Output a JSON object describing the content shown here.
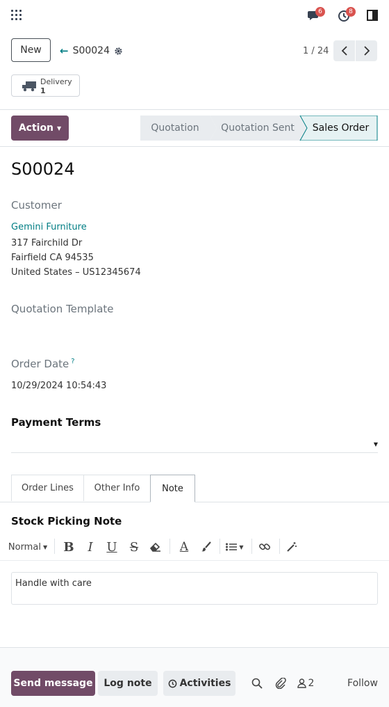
{
  "header": {
    "messages_badge": "6",
    "activities_badge": "8"
  },
  "control_panel": {
    "new_label": "New",
    "breadcrumb": "S00024",
    "pager": "1 / 24",
    "smart_button": {
      "title": "Delivery",
      "count": "1"
    }
  },
  "statusbar": {
    "action_label": "Action",
    "stages": [
      "Quotation",
      "Quotation Sent",
      "Sales Order"
    ],
    "active_stage": "Sales Order"
  },
  "form": {
    "title": "S00024",
    "customer_label": "Customer",
    "customer_name": "Gemini Furniture",
    "address_line1": "317 Fairchild Dr",
    "address_line2": "Fairfield CA 94535",
    "address_line3": "United States – US12345674",
    "quotation_template_label": "Quotation Template",
    "order_date_label": "Order Date",
    "order_date_help": "?",
    "order_date_value": "10/29/2024 10:54:43",
    "payment_terms_label": "Payment Terms",
    "payment_terms_value": ""
  },
  "tabs": [
    {
      "label": "Order Lines"
    },
    {
      "label": "Other Info"
    },
    {
      "label": "Note"
    }
  ],
  "note": {
    "heading": "Stock Picking Note",
    "style_select": "Normal",
    "content": "Handle with care"
  },
  "chatter": {
    "send_message": "Send message",
    "log_note": "Log note",
    "activities": "Activities",
    "followers_count": "2",
    "follow": "Follow"
  },
  "colors": {
    "brand": "#714b67",
    "link": "#017e84",
    "active_stage_bg": "#e6f2f3",
    "badge": "#d9534f"
  }
}
